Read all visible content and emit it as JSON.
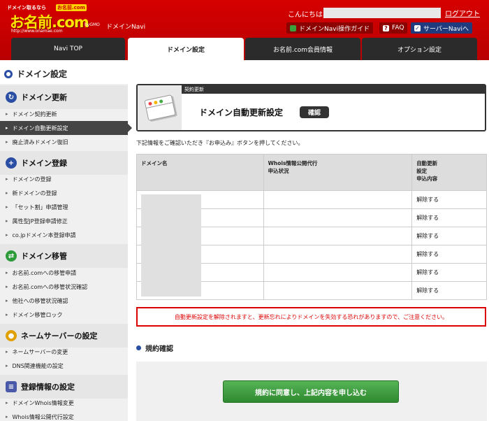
{
  "header": {
    "logo_tagline": "ドメイン取るなら",
    "logo_tagline_badge": "お名前.com",
    "logo_text": "お名前.com",
    "logo_url": "http://www.onamae.com",
    "logo_gmo": "byGMO",
    "app_name": "ドメインNavi",
    "greeting": "こんにちは、",
    "logout": "ログアウト",
    "guide_button": "ドメインNavi操作ガイド",
    "faq_button": "FAQ",
    "server_button": "サーバーNaviへ"
  },
  "tabs": [
    {
      "label": "Navi TOP",
      "active": false
    },
    {
      "label": "ドメイン設定",
      "active": true
    },
    {
      "label": "お名前.com会員情報",
      "active": false
    },
    {
      "label": "オプション設定",
      "active": false
    }
  ],
  "page_title": "ドメイン設定",
  "sidebar": {
    "sections": [
      {
        "title": "ドメイン更新",
        "icon": "refresh-icon",
        "items": [
          "ドメイン契約更新",
          "ドメイン自動更新設定",
          "廃止済みドメイン復旧"
        ]
      },
      {
        "title": "ドメイン登録",
        "icon": "plus-icon",
        "items": [
          "ドメインの登録",
          "新ドメインの登録",
          "「セット割」申請管理",
          "属性型JP登録申請修正",
          "co.jpドメイン本登録申請"
        ]
      },
      {
        "title": "ドメイン移管",
        "icon": "transfer-icon",
        "items": [
          "お名前.comへの移管申請",
          "お名前.comへの移管状況確認",
          "他社への移管状況確認",
          "ドメイン移管ロック"
        ]
      },
      {
        "title": "ネームサーバーの設定",
        "icon": "people-icon",
        "items": [
          "ネームサーバーの変更",
          "DNS関連機能の設定"
        ]
      },
      {
        "title": "登録情報の設定",
        "icon": "document-icon",
        "items": [
          "ドメインWhois情報変更",
          "Whois情報公開代行設定"
        ]
      }
    ],
    "active_item": "ドメイン自動更新設定"
  },
  "main": {
    "caption": "契約更新",
    "title": "ドメイン自動更新設定",
    "badge": "確認",
    "notice": "下記情報をご確認いただき『お申込み』ボタンを押してください。",
    "table": {
      "headers": [
        "ドメイン名",
        "Whois情報公開代行\n申込状況",
        "自動更新\n設定\n申込内容"
      ],
      "rows": [
        {
          "domain": "",
          "whois": "",
          "action": "解除する"
        },
        {
          "domain": "",
          "whois": "",
          "action": "解除する"
        },
        {
          "domain": "",
          "whois": "",
          "action": "解除する"
        },
        {
          "domain": "",
          "whois": "",
          "action": "解除する"
        },
        {
          "domain": "",
          "whois": "",
          "action": "解除する"
        },
        {
          "domain": "",
          "whois": "",
          "action": "解除する"
        }
      ]
    },
    "warning": "自動更新設定を解除されますと、更新忘れによりドメインを失効する恐れがありますので、ご注意ください。",
    "terms_title": "規約確認",
    "agree_button": "規約に同意し、上記内容を申し込む"
  },
  "colors": {
    "header_red": "#d00000",
    "tab_dark": "#2b2b2b",
    "accent_blue": "#2a4ea3",
    "warning_red": "#dd0000",
    "agree_green": "#3a9a3a"
  }
}
